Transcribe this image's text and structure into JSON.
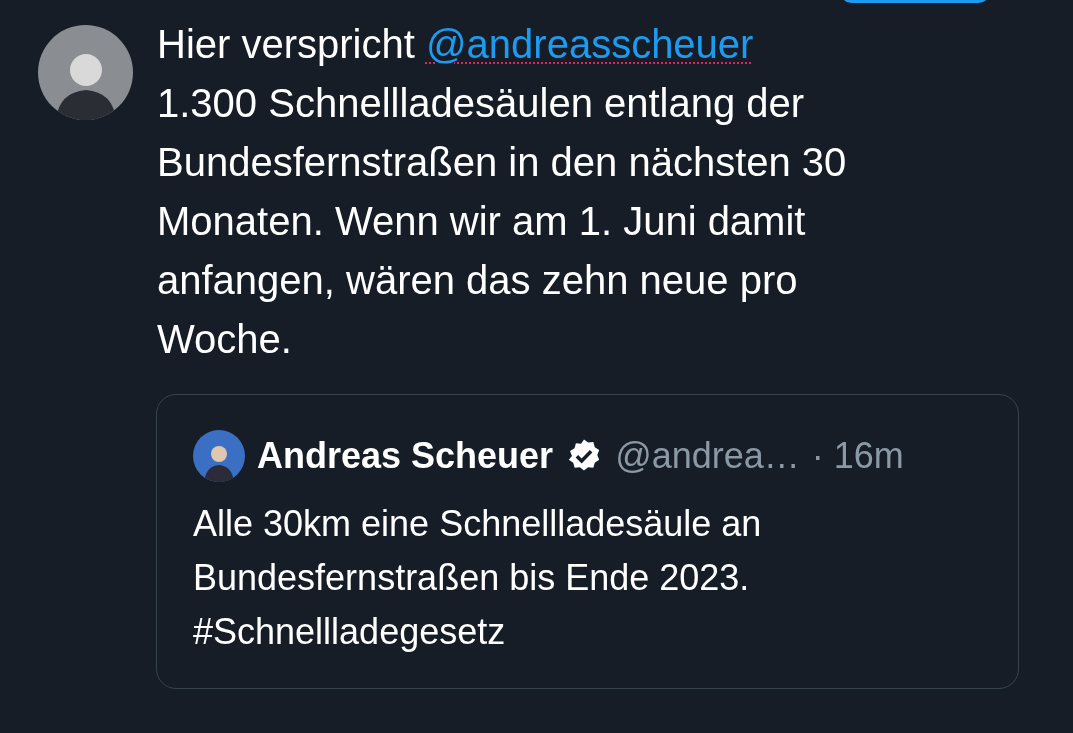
{
  "tweet": {
    "text_before": "Hier verspricht",
    "mention": "@andreasscheuer",
    "mention_misspelled": true,
    "text_after": "1.300 Schnellladesäulen entlang der\nBundesfernstraßen in den nächsten 30\nMonaten. Wenn wir am 1. Juni damit\nanfangen, wären das zehn neue pro\nWoche."
  },
  "quote": {
    "name": "Andreas Scheuer",
    "verified": true,
    "handle": "@andrea…",
    "time": "· 16m",
    "text": "Alle 30km eine Schnellladesäule an\nBundesfernstraßen bis Ende 2023.\n#Schnellladegesetz"
  }
}
